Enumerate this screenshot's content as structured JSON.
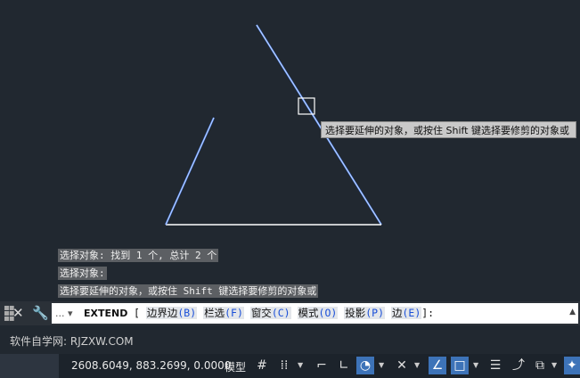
{
  "tooltip": "选择要延伸的对象，或按住 Shift 键选择要修剪的对象或",
  "history": [
    "选择对象: 找到 1 个, 总计 2 个",
    "选择对象:",
    "选择要延伸的对象，或按住 Shift 键选择要修剪的对象或"
  ],
  "command": {
    "prefix": "...",
    "name": "EXTEND",
    "open_bracket": "[",
    "options": [
      {
        "label": "边界边",
        "key": "(B)"
      },
      {
        "label": "栏选",
        "key": "(F)"
      },
      {
        "label": "窗交",
        "key": "(C)"
      },
      {
        "label": "模式",
        "key": "(O)"
      },
      {
        "label": "投影",
        "key": "(P)"
      },
      {
        "label": "边",
        "key": "(E)"
      }
    ],
    "close": "]:"
  },
  "watermark": "软件自学网: RJZXW.COM",
  "status": {
    "coordinates": "2608.6049, 883.2699, 0.0000",
    "model_label": "模型"
  },
  "colors": {
    "canvas_bg": "#212830",
    "line": "#5b8fff",
    "accent": "#3d73b8"
  }
}
